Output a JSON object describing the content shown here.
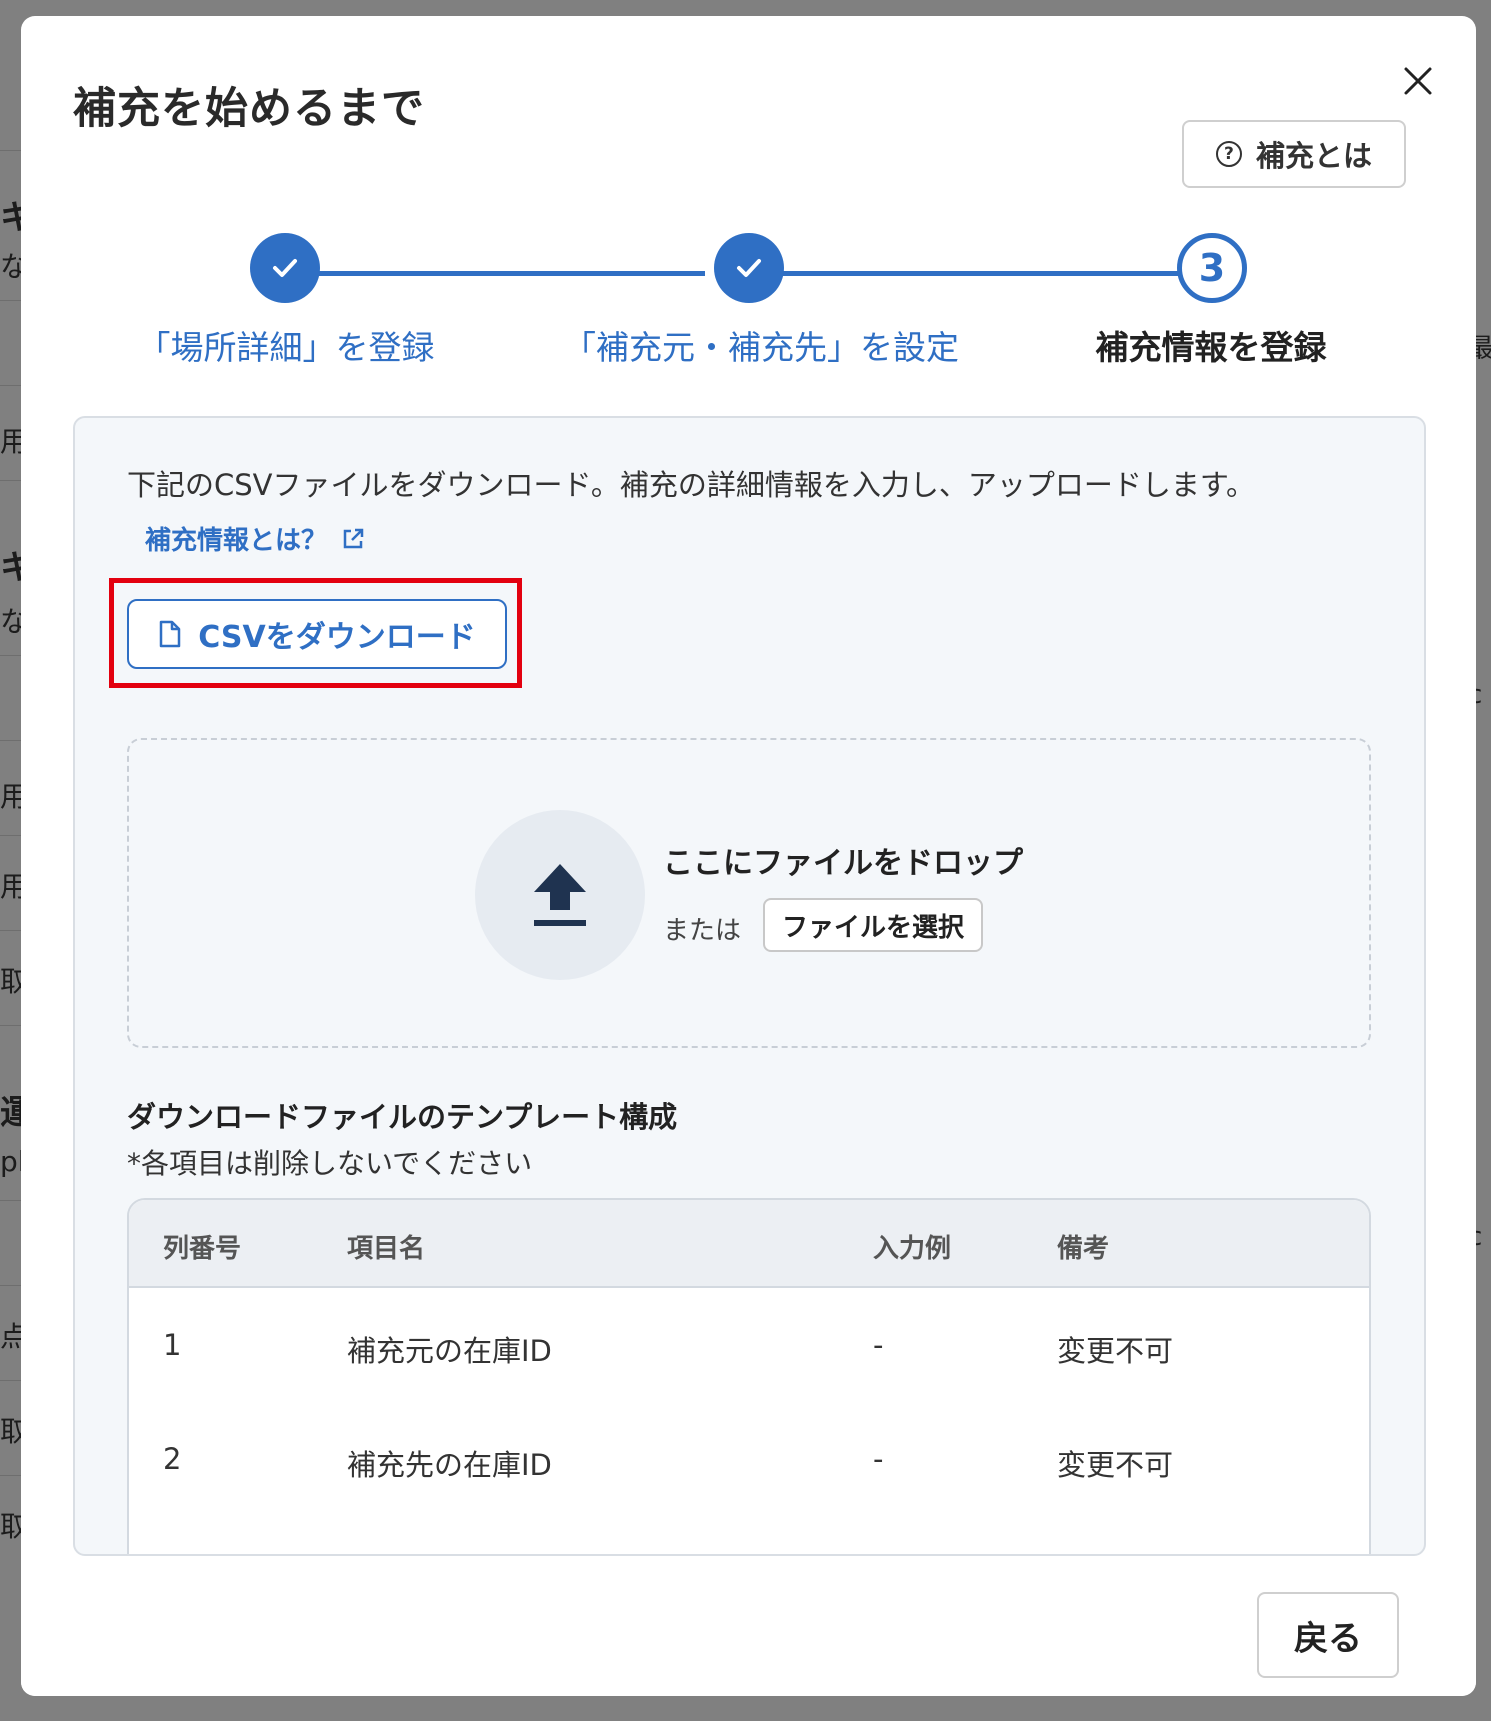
{
  "modal": {
    "title": "補充を始めるまで",
    "help_label": "補充とは",
    "steps": [
      {
        "label": "「場所詳細」を登録",
        "state": "done"
      },
      {
        "label": "「補充元・補充先」を設定",
        "state": "done"
      },
      {
        "label": "補充情報を登録",
        "state": "current",
        "number": "3"
      }
    ],
    "description": "下記のCSVファイルをダウンロード。補充の詳細情報を入力し、アップロードします。",
    "info_link": "補充情報とは？",
    "csv_download_label": "CSVをダウンロード",
    "dropzone": {
      "title": "ここにファイルをドロップ",
      "or_text": "または",
      "select_label": "ファイルを選択"
    },
    "template": {
      "title": "ダウンロードファイルのテンプレート構成",
      "note": "*各項目は削除しないでください",
      "headers": [
        "列番号",
        "項目名",
        "入力例",
        "備考"
      ],
      "rows": [
        [
          "1",
          "補充元の在庫ID",
          "-",
          "変更不可"
        ],
        [
          "2",
          "補充先の在庫ID",
          "-",
          "変更不可"
        ]
      ]
    },
    "back_label": "戻る"
  },
  "background": {
    "left_fragments": [
      "キ",
      "な",
      "用",
      "キ",
      "な",
      "用",
      "用",
      "取",
      "運",
      "pl",
      "点",
      "取",
      "取"
    ],
    "right_fragments": [
      "最",
      "c",
      "c"
    ]
  },
  "colors": {
    "accent": "#2f6fc4",
    "highlight": "#e3000f"
  }
}
